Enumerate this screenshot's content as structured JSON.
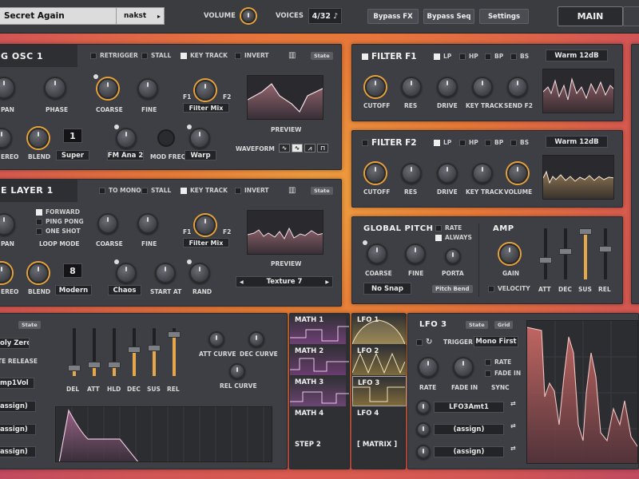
{
  "topbar": {
    "preset": "Secret Again",
    "author": "nakst",
    "volume_label": "VOLUME",
    "voices_label": "VOICES",
    "voices_value": "4/32",
    "note_icon": "♪",
    "bypass_fx": "Bypass FX",
    "bypass_seq": "Bypass Seq",
    "settings": "Settings",
    "main_tab": "MAIN"
  },
  "osc1": {
    "title": "G OSC 1",
    "retrigger": "RETRIGGER",
    "stall": "STALL",
    "keytrack": "KEY TRACK",
    "invert": "INVERT",
    "state": "State",
    "pan": "PAN",
    "phase": "PHASE",
    "coarse": "COARSE",
    "fine": "FINE",
    "f1": "F1",
    "f2": "F2",
    "filter_mix": "Filter Mix",
    "preview": "PREVIEW",
    "stereo": "EREO",
    "blend": "BLEND",
    "unison": "1",
    "super": "Super",
    "fm": "FM Ana 2",
    "modfreq": "MOD FREQ",
    "warp": "Warp",
    "waveform": "WAVEFORM"
  },
  "layer1": {
    "title": "E LAYER 1",
    "tomono": "TO MONO",
    "stall": "STALL",
    "keytrack": "KEY TRACK",
    "invert": "INVERT",
    "state": "State",
    "pan": "PAN",
    "forward": "FORWARD",
    "pingpong": "PING PONG",
    "oneshot": "ONE SHOT",
    "loopmode": "LOOP MODE",
    "coarse": "COARSE",
    "fine": "FINE",
    "f1": "F1",
    "f2": "F2",
    "filter_mix": "Filter Mix",
    "preview": "PREVIEW",
    "stereo": "EREO",
    "blend": "BLEND",
    "unison": "8",
    "modern": "Modern",
    "chaos": "Chaos",
    "startat": "START AT",
    "rand": "RAND",
    "texture": "Texture 7",
    "prev_arrow": "◀",
    "next_arrow": "▶"
  },
  "filter1": {
    "title": "FILTER F1",
    "lp": "LP",
    "hp": "HP",
    "bp": "BP",
    "bs": "BS",
    "type": "Warm 12dB",
    "cutoff": "CUTOFF",
    "res": "RES",
    "drive": "DRIVE",
    "keytrack": "KEY TRACK",
    "send": "SEND F2"
  },
  "filter2": {
    "title": "FILTER F2",
    "lp": "LP",
    "hp": "HP",
    "bp": "BP",
    "bs": "BS",
    "type": "Warm 12dB",
    "cutoff": "CUTOFF",
    "res": "RES",
    "drive": "DRIVE",
    "keytrack": "KEY TRACK",
    "volume": "VOLUME"
  },
  "pitch": {
    "title": "GLOBAL PITCH",
    "rate": "RATE",
    "always": "ALWAYS",
    "coarse": "COARSE",
    "fine": "FINE",
    "porta": "PORTA",
    "nosnap": "No Snap",
    "pitchbend": "Pitch Bend"
  },
  "amp": {
    "title": "AMP",
    "gain": "GAIN",
    "velocity": "VELOCITY",
    "att": "ATT",
    "dec": "DEC",
    "sus": "SUS",
    "rel": "REL",
    "levels": [
      0.35,
      0.55,
      1.0,
      0.6
    ]
  },
  "env": {
    "state": "State",
    "polyzero": "oly Zero",
    "terelease": "TE RELEASE",
    "mp1vol": "mp1Vol",
    "assign": "assign)",
    "del": "DEL",
    "att": "ATT",
    "hld": "HLD",
    "dec": "DEC",
    "sus": "SUS",
    "rel": "REL",
    "attcurve": "ATT CURVE",
    "deccurve": "DEC CURVE",
    "relcurve": "REL CURVE",
    "levels": [
      0.12,
      0.2,
      0.2,
      0.55,
      0.6,
      0.92
    ]
  },
  "math": {
    "items": [
      "MATH 1",
      "MATH 2",
      "MATH 3",
      "MATH 4",
      "STEP 2"
    ]
  },
  "lfo": {
    "items": [
      "LFO 1",
      "LFO 2",
      "LFO 3",
      "LFO 4",
      "[ MATRIX ]"
    ],
    "title": "LFO 3",
    "state": "State",
    "grid": "Grid",
    "trigger": "TRIGGER",
    "mode": "Mono First",
    "rate": "RATE",
    "fadein": "FADE IN",
    "sync": "SYNC",
    "chk_rate": "RATE",
    "chk_fadein": "FADE IN",
    "mod1": "LFO3Amt1",
    "mod2": "(assign)",
    "mod3": "(assign)"
  }
}
